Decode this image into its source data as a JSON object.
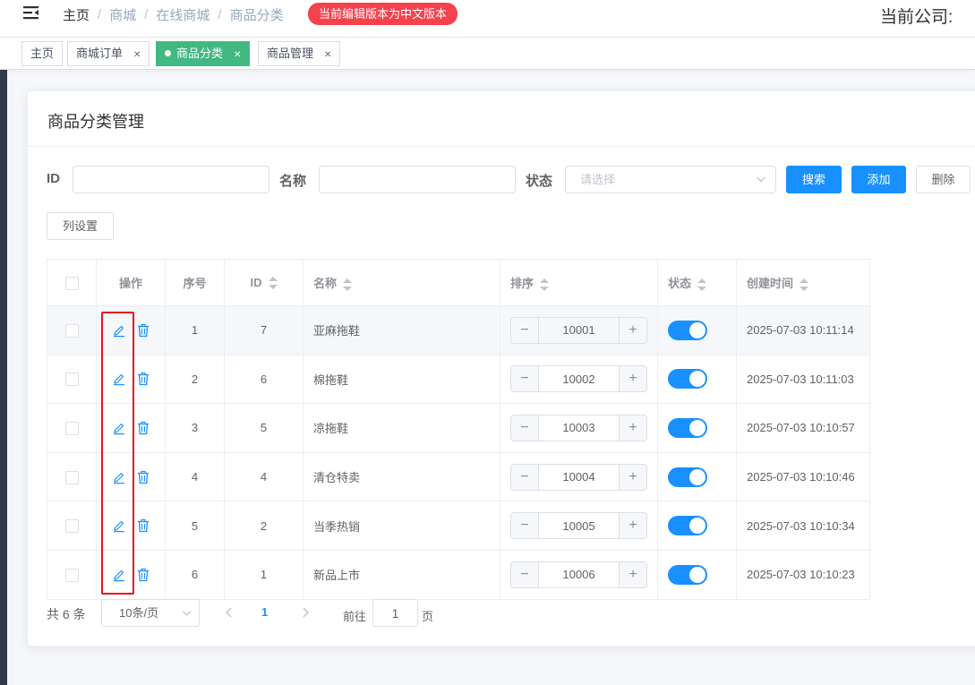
{
  "header": {
    "breadcrumb": [
      "主页",
      "商城",
      "在线商城",
      "商品分类"
    ],
    "notice": "当前编辑版本为中文版本",
    "company_label": "当前公司:"
  },
  "tags": [
    {
      "label": "主页",
      "closable": false,
      "active": false
    },
    {
      "label": "商城订单",
      "closable": true,
      "active": false
    },
    {
      "label": "商品分类",
      "closable": true,
      "active": true
    },
    {
      "label": "商品管理",
      "closable": true,
      "active": false
    }
  ],
  "card": {
    "title": "商品分类管理"
  },
  "filters": {
    "id_label": "ID",
    "id_value": "",
    "name_label": "名称",
    "name_value": "",
    "status_label": "状态",
    "status_placeholder": "请选择",
    "search_button": "搜索",
    "add_button": "添加",
    "delete_button": "删除",
    "column_settings_button": "列设置"
  },
  "table": {
    "columns": [
      "操作",
      "序号",
      "ID",
      "名称",
      "排序",
      "状态",
      "创建时间"
    ],
    "rows": [
      {
        "seq": "1",
        "id": "7",
        "name": "亚麻拖鞋",
        "sort": "10001",
        "enabled": true,
        "created": "2025-07-03 10:11:14"
      },
      {
        "seq": "2",
        "id": "6",
        "name": "棉拖鞋",
        "sort": "10002",
        "enabled": true,
        "created": "2025-07-03 10:11:03"
      },
      {
        "seq": "3",
        "id": "5",
        "name": "凉拖鞋",
        "sort": "10003",
        "enabled": true,
        "created": "2025-07-03 10:10:57"
      },
      {
        "seq": "4",
        "id": "4",
        "name": "清仓特卖",
        "sort": "10004",
        "enabled": true,
        "created": "2025-07-03 10:10:46"
      },
      {
        "seq": "5",
        "id": "2",
        "name": "当季热销",
        "sort": "10005",
        "enabled": true,
        "created": "2025-07-03 10:10:34"
      },
      {
        "seq": "6",
        "id": "1",
        "name": "新品上市",
        "sort": "10006",
        "enabled": true,
        "created": "2025-07-03 10:10:23"
      }
    ]
  },
  "pagination": {
    "total_text": "共 6 条",
    "page_size": "10条/页",
    "current_page": "1",
    "goto_label": "前往",
    "goto_value": "1",
    "page_unit": "页"
  },
  "colors": {
    "primary": "#1890ff",
    "active_tag": "#42b983",
    "notice": "#f5424d",
    "highlight_box": "#e8141f"
  }
}
